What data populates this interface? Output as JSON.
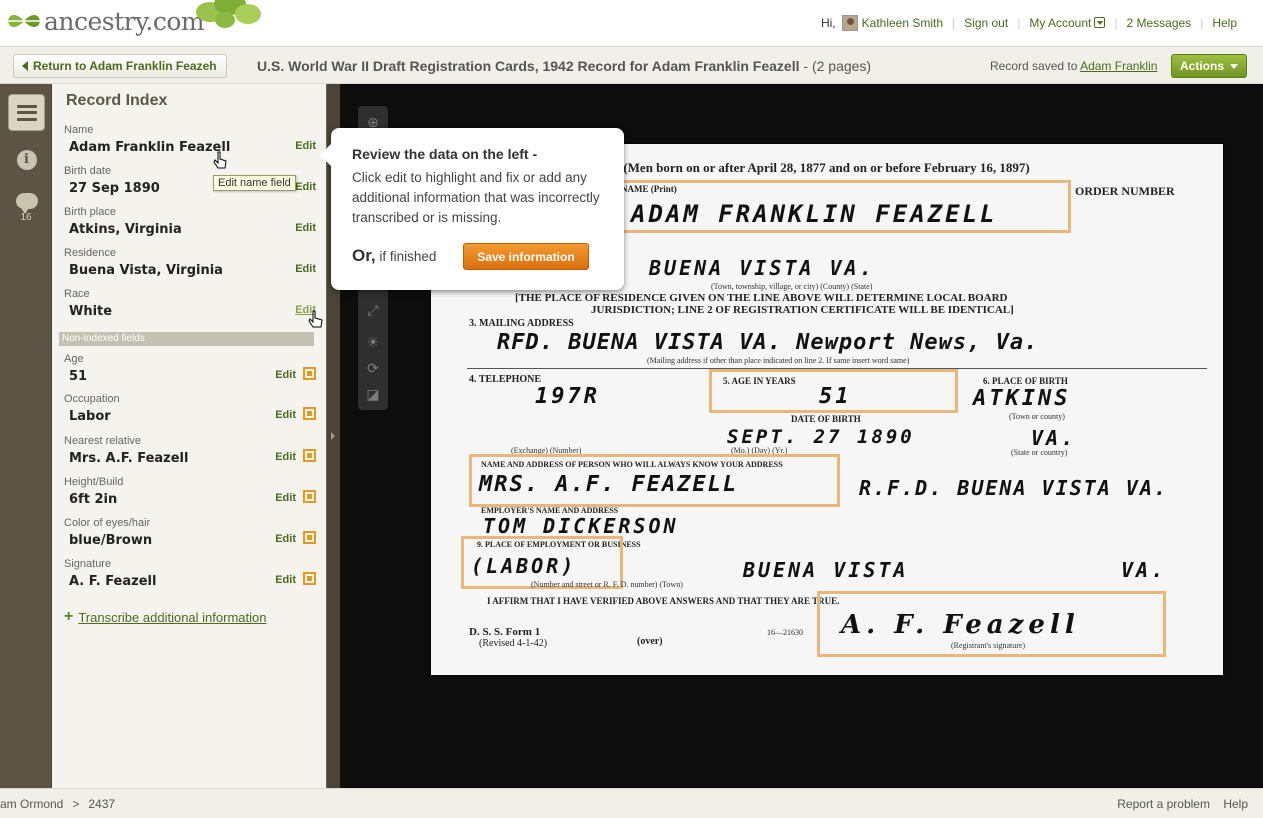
{
  "header": {
    "logo_text": "ancestry.com",
    "greeting": "Hi,",
    "user_name": "Kathleen Smith",
    "sign_out": "Sign out",
    "my_account": "My Account",
    "messages": "2 Messages",
    "help": "Help"
  },
  "subheader": {
    "return_label": "Return to Adam Franklin Feazeh",
    "record_title": "U.S. World War II Draft Registration Cards, 1942 Record for Adam Franklin Feazell",
    "pages": " - (2 pages)",
    "saved_prefix": "Record saved to",
    "saved_link": "Adam Franklin",
    "actions_label": "Actions"
  },
  "rail": {
    "comment_count": "16"
  },
  "panel": {
    "title": "Record Index",
    "edit_label": "Edit",
    "tooltip": "Edit name field",
    "nonindexed_header": "Non-indexed fields",
    "transcribe_link": "Transcribe additional information",
    "fields": [
      {
        "label": "Name",
        "value": "Adam Franklin Feazell"
      },
      {
        "label": "Birth date",
        "value": "27 Sep 1890"
      },
      {
        "label": "Birth place",
        "value": "Atkins, Virginia"
      },
      {
        "label": "Residence",
        "value": "Buena Vista, Virginia"
      },
      {
        "label": "Race",
        "value": "White"
      }
    ],
    "nonindexed": [
      {
        "label": "Age",
        "value": "51"
      },
      {
        "label": "Occupation",
        "value": "Labor"
      },
      {
        "label": "Nearest relative",
        "value": "Mrs. A.F. Feazell"
      },
      {
        "label": "Height/Build",
        "value": "6ft 2in"
      },
      {
        "label": "Color of eyes/hair",
        "value": "blue/Brown"
      },
      {
        "label": "Signature",
        "value": "A. F. Feazell"
      }
    ]
  },
  "callout": {
    "title": "Review the data on the left -",
    "body": "Click edit to highlight and fix or add any additional information that was incorrectly transcribed or is missing.",
    "or": "Or,",
    "or_rest": " if finished",
    "save_button": "Save information"
  },
  "document": {
    "header_line": "-(Men born on or after April 28, 1877 and on or before February 16, 1897)",
    "name_print": "NAME (Print)",
    "order_number": "ORDER NUMBER",
    "hw_name": "ADAM  FRANKLIN FEAZELL",
    "hw_residence": "BUENA VISTA    VA.",
    "res_caption": "(Town, township, village, or city)                    (County)                  (State)",
    "residence_note": "[THE PLACE OF RESIDENCE GIVEN ON THE LINE ABOVE WILL DETERMINE LOCAL BOARD",
    "residence_note2": "JURISDICTION; LINE 2 OF REGISTRATION CERTIFICATE WILL BE IDENTICAL]",
    "mailing_label": "3. MAILING ADDRESS",
    "hw_mailing": "RFD. BUENA VISTA VA. Newport News, Va.",
    "mailing_caption": "(Mailing address if other than place indicated on line 2.  If same insert word same)",
    "telephone_label": "4. TELEPHONE",
    "hw_phone": "197R",
    "age_label": "5. AGE IN YEARS",
    "hw_age": "51",
    "birthplace_label": "6. PLACE OF BIRTH",
    "hw_birthplace": "ATKINS",
    "town_county": "(Town or county)",
    "dob_label": "DATE OF BIRTH",
    "hw_dob": "SEPT. 27  1890",
    "hw_state": "VA.",
    "phone_caption": "(Exchange)         (Number)",
    "dob_caption": "(Mo.)       (Day)       (Yr.)",
    "state_caption": "(State or country)",
    "relative_label": "NAME AND ADDRESS OF PERSON WHO WILL ALWAYS KNOW YOUR ADDRESS",
    "hw_relative": "MRS. A.F. FEAZELL",
    "hw_relative_addr": "R.F.D. BUENA VISTA VA.",
    "employer_label": "EMPLOYER'S NAME AND ADDRESS",
    "hw_employer": "TOM DICKERSON",
    "employment_label": "9. PLACE OF EMPLOYMENT OR BUSINESS",
    "hw_employment": "(LABOR)",
    "hw_employment_place": "BUENA VISTA",
    "hw_employment_state": "VA.",
    "employment_caption": "(Number and street or R. F. D. number)              (Town)",
    "affirm": "I AFFIRM THAT I HAVE VERIFIED ABOVE ANSWERS AND THAT THEY ARE TRUE.",
    "form_label": "D. S. S. Form 1",
    "form_revised": "(Revised 4-1-42)",
    "over": "(over)",
    "form_number": "16—21630",
    "hw_signature": "A. F. Feazell",
    "sig_caption": "(Registrant's signature)"
  },
  "footer": {
    "crumb1": "am Ormond",
    "crumb_sep": ">",
    "crumb2": "2437",
    "report": "Report a problem",
    "help": "Help"
  },
  "colors": {
    "brand_green": "#4a6b1f",
    "highlight_orange": "#e9b77a",
    "save_orange": "#e8851f"
  }
}
